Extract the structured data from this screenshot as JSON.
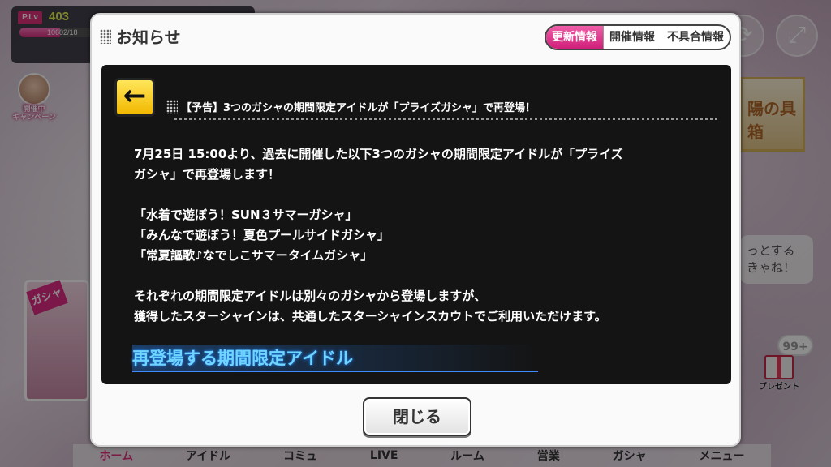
{
  "hud": {
    "plv_label": "P.Lv",
    "plv_value": "403",
    "exp_text": "10602/18",
    "exp_fraction": 0.55
  },
  "campaign": {
    "label_line1": "開催中",
    "label_line2": "キャンペーン"
  },
  "side": {
    "gacha_label": "ガシャ",
    "banner_text": "陽の具箱",
    "speech_text": "っとする きゃね！",
    "present_badge": "99+",
    "present_label": "プレゼント"
  },
  "bottom_nav": [
    "ホーム",
    "アイドル",
    "コミュ",
    "LIVE",
    "ルーム",
    "営業",
    "ガシャ",
    "メニュー"
  ],
  "dialog": {
    "title": "お知らせ",
    "tabs": [
      "更新情報",
      "開催情報",
      "不具合情報"
    ],
    "active_tab": 0,
    "back_symbol": "←",
    "article_title": "【予告】3つのガシャの期間限定アイドルが「プライズガシャ」で再登場！",
    "body": {
      "para1_line1": "7月25日 15:00より、過去に開催した以下3つのガシャの期間限定アイドルが「プライズ",
      "para1_line2": "ガシャ」で再登場します！",
      "list": [
        "「水着で遊ぼう！SUN３サマーガシャ」",
        "「みんなで遊ぼう！夏色プールサイドガシャ」",
        "「常夏謳歌♪なでしこサマータイムガシャ」"
      ],
      "para2_line1": "それぞれの期間限定アイドルは別々のガシャから登場しますが、",
      "para2_line2": "獲得したスターシャインは、共通したスターシャインスカウトでご利用いただけます。"
    },
    "section_heading": "再登場する期間限定アイドル",
    "close_label": "閉じる"
  }
}
